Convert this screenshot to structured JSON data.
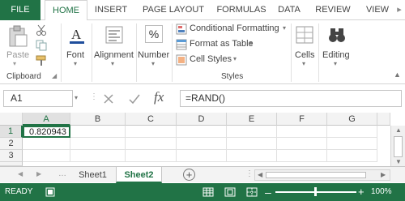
{
  "ribbon_tabs": [
    "FILE",
    "HOME",
    "INSERT",
    "PAGE LAYOUT",
    "FORMULAS",
    "DATA",
    "REVIEW",
    "VIEW"
  ],
  "clipboard": {
    "paste_label": "Paste",
    "group_label": "Clipboard"
  },
  "font": {
    "label": "Font"
  },
  "alignment": {
    "label": "Alignment"
  },
  "number": {
    "label": "Number",
    "icon_text": "%"
  },
  "styles": {
    "conditional_formatting": "Conditional Formatting",
    "format_as_table": "Format as Table",
    "cell_styles": "Cell Styles",
    "group_label": "Styles"
  },
  "cells": {
    "label": "Cells"
  },
  "editing": {
    "label": "Editing"
  },
  "formula_bar": {
    "name_box": "A1",
    "fx": "fx",
    "formula": "=RAND()"
  },
  "columns": [
    "A",
    "B",
    "C",
    "D",
    "E",
    "F",
    "G"
  ],
  "rows": [
    "1",
    "2",
    "3"
  ],
  "cells_data": {
    "A1": "0.820943"
  },
  "sheets": [
    "Sheet1",
    "Sheet2"
  ],
  "status": {
    "mode": "READY",
    "zoom": "100%"
  },
  "colors": {
    "accent": "#217346"
  }
}
